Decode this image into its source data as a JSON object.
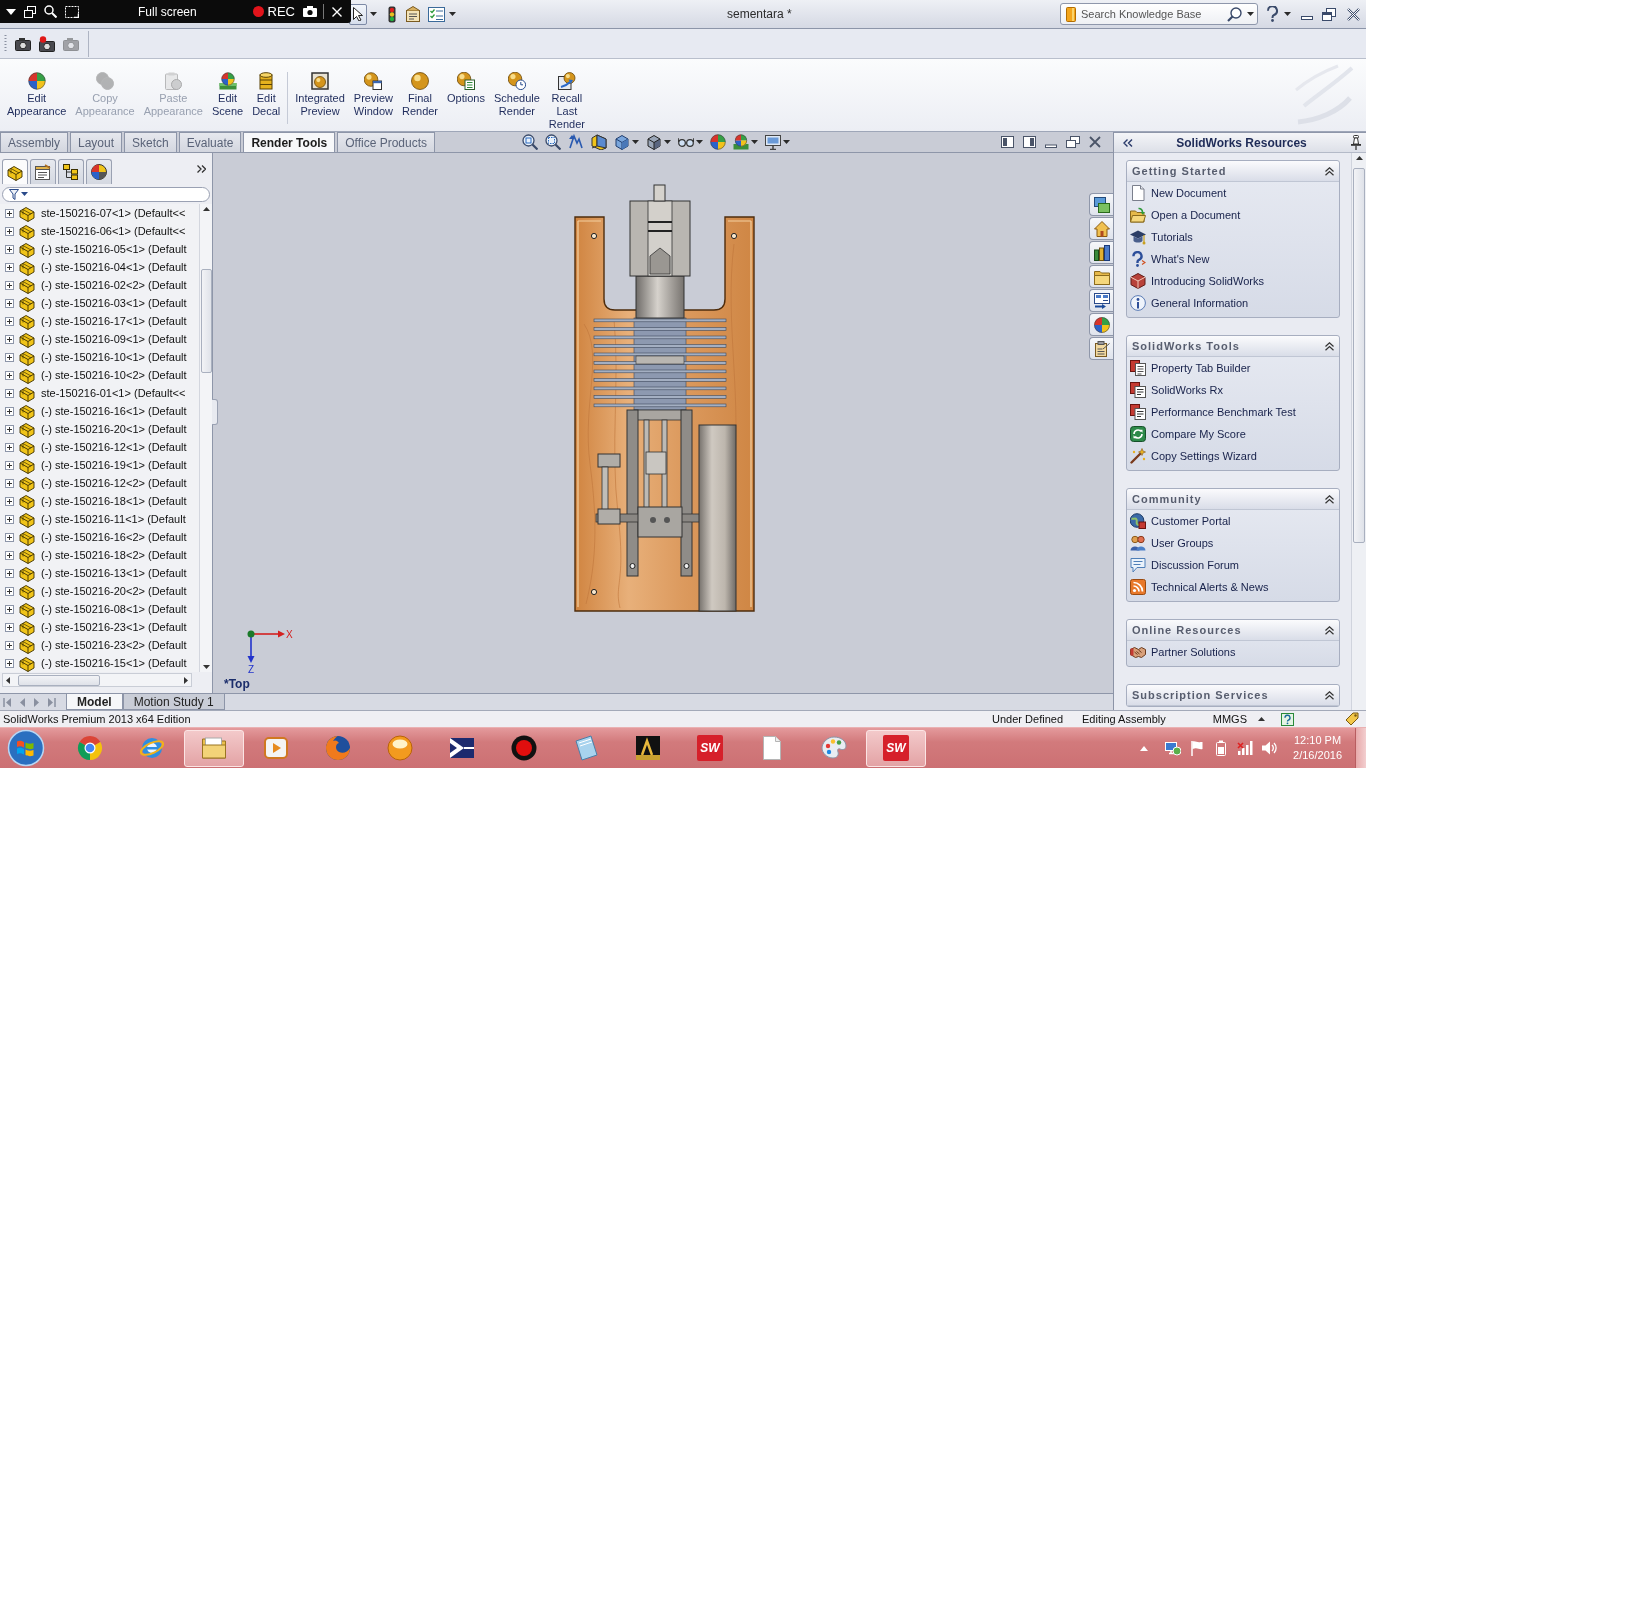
{
  "recorder": {
    "mode": "Full screen",
    "rec_label": "REC"
  },
  "window": {
    "title": "sementara *",
    "search": {
      "placeholder": "Search Knowledge Base"
    }
  },
  "screen_capture": {
    "buttons": [
      {
        "disabled": false
      },
      {
        "disabled": false
      },
      {
        "disabled": true
      }
    ]
  },
  "command_manager": {
    "groups": [
      {
        "buttons": [
          {
            "label": "Edit Appearance",
            "disabled": false
          },
          {
            "label": "Copy Appearance",
            "disabled": true
          },
          {
            "label": "Paste Appearance",
            "disabled": true
          },
          {
            "label": "Edit Scene",
            "disabled": false
          },
          {
            "label": "Edit Decal",
            "disabled": false
          }
        ]
      },
      {
        "buttons": [
          {
            "label": "Integrated Preview",
            "disabled": false
          },
          {
            "label": "Preview Window",
            "disabled": false
          },
          {
            "label": "Final Render",
            "disabled": false
          },
          {
            "label": "Options",
            "disabled": false
          },
          {
            "label": "Schedule Render",
            "disabled": false
          },
          {
            "label": "Recall Last Render",
            "disabled": false
          }
        ]
      }
    ]
  },
  "tabs": [
    {
      "label": "Assembly",
      "selected": false
    },
    {
      "label": "Layout",
      "selected": false
    },
    {
      "label": "Sketch",
      "selected": false
    },
    {
      "label": "Evaluate",
      "selected": false
    },
    {
      "label": "Render Tools",
      "selected": true
    },
    {
      "label": "Office Products",
      "selected": false
    }
  ],
  "feature_manager": {
    "tabs": [
      {
        "selected": true
      },
      {
        "selected": false
      },
      {
        "selected": false
      },
      {
        "selected": false
      }
    ],
    "items": [
      {
        "label": "ste-150216-07<1> (Default<<",
        "expanded": false
      },
      {
        "label": "ste-150216-06<1> (Default<<",
        "expanded": false
      },
      {
        "label": "(-) ste-150216-05<1> (Default",
        "expanded": false
      },
      {
        "label": "(-) ste-150216-04<1> (Default",
        "expanded": false
      },
      {
        "label": "(-) ste-150216-02<2> (Default",
        "expanded": false
      },
      {
        "label": "(-) ste-150216-03<1> (Default",
        "expanded": false
      },
      {
        "label": "(-) ste-150216-17<1> (Default",
        "expanded": false
      },
      {
        "label": "(-) ste-150216-09<1> (Default",
        "expanded": false
      },
      {
        "label": "(-) ste-150216-10<1> (Default",
        "expanded": false
      },
      {
        "label": "(-) ste-150216-10<2> (Default",
        "expanded": false
      },
      {
        "label": "ste-150216-01<1> (Default<<",
        "expanded": false
      },
      {
        "label": "(-) ste-150216-16<1> (Default",
        "expanded": false
      },
      {
        "label": "(-) ste-150216-20<1> (Default",
        "expanded": false
      },
      {
        "label": "(-) ste-150216-12<1> (Default",
        "expanded": false
      },
      {
        "label": "(-) ste-150216-19<1> (Default",
        "expanded": false
      },
      {
        "label": "(-) ste-150216-12<2> (Default",
        "expanded": false
      },
      {
        "label": "(-) ste-150216-18<1> (Default",
        "expanded": false
      },
      {
        "label": "(-) ste-150216-11<1> (Default",
        "expanded": false
      },
      {
        "label": "(-) ste-150216-16<2> (Default",
        "expanded": false
      },
      {
        "label": "(-) ste-150216-18<2> (Default",
        "expanded": false
      },
      {
        "label": "(-) ste-150216-13<1> (Default",
        "expanded": false
      },
      {
        "label": "(-) ste-150216-20<2> (Default",
        "expanded": false
      },
      {
        "label": "(-) ste-150216-08<1> (Default",
        "expanded": false
      },
      {
        "label": "(-) ste-150216-23<1> (Default",
        "expanded": false
      },
      {
        "label": "(-) ste-150216-23<2> (Default",
        "expanded": false
      },
      {
        "label": "(-) ste-150216-15<1> (Default",
        "expanded": false
      }
    ]
  },
  "viewport": {
    "view_name": "*Top",
    "triad": {
      "x_label": "X",
      "z_label": "Z"
    }
  },
  "resources": {
    "title": "SolidWorks Resources",
    "sections": [
      {
        "title": "Getting Started",
        "expanded": true,
        "items": [
          "New Document",
          "Open a Document",
          "Tutorials",
          "What's New",
          "Introducing SolidWorks",
          "General Information"
        ]
      },
      {
        "title": "SolidWorks Tools",
        "expanded": true,
        "items": [
          "Property Tab Builder",
          "SolidWorks Rx",
          "Performance Benchmark Test",
          "Compare My Score",
          "Copy Settings Wizard"
        ]
      },
      {
        "title": "Community",
        "expanded": true,
        "items": [
          "Customer Portal",
          "User Groups",
          "Discussion Forum",
          "Technical Alerts & News"
        ]
      },
      {
        "title": "Online Resources",
        "expanded": true,
        "items": [
          "Partner Solutions"
        ]
      },
      {
        "title": "Subscription Services",
        "expanded": true
      }
    ]
  },
  "bottom_tabs": [
    {
      "label": "Model",
      "selected": true
    },
    {
      "label": "Motion Study 1",
      "selected": false
    }
  ],
  "status_bar": {
    "edition": "SolidWorks Premium 2013 x64 Edition",
    "rebuild_state": "Under Defined",
    "mode": "Editing Assembly",
    "units": "MMGS"
  },
  "taskbar": {
    "buttons": [
      {
        "highlighted": false
      },
      {
        "highlighted": false
      },
      {
        "highlighted": true
      },
      {
        "highlighted": false
      },
      {
        "highlighted": false
      },
      {
        "highlighted": false
      },
      {
        "highlighted": false
      },
      {
        "highlighted": false
      },
      {
        "highlighted": false
      },
      {
        "highlighted": false
      },
      {
        "highlighted": false,
        "logo_text": "SW"
      },
      {
        "highlighted": false
      },
      {
        "highlighted": false
      },
      {
        "highlighted": true,
        "logo_text": "SW"
      }
    ],
    "clock": {
      "time": "12:10 PM",
      "date": "2/16/2016"
    }
  }
}
